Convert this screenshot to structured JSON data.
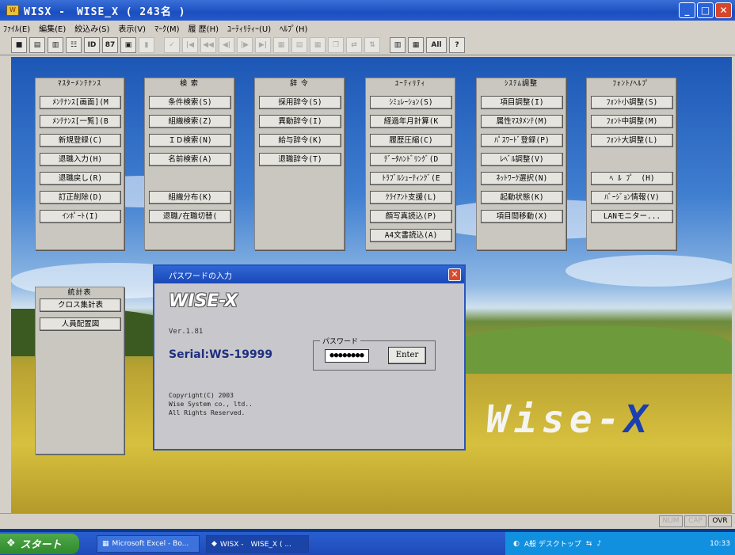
{
  "window": {
    "title": "WISX -　WISE_X ( 243名 )",
    "min": "_",
    "max": "□",
    "close": "✕"
  },
  "menu": [
    "ﾌｧｲﾙ(E)",
    "編集(E)",
    "絞込み(S)",
    "表示(V)",
    "ﾏｰｸ(M)",
    "履 歴(H)",
    "ﾕｰﾃｨﾘﾃｨｰ(U)",
    "ﾍﾙﾌﾟ(H)"
  ],
  "toolbar": {
    "id": "ID",
    "nums": "87",
    "all": "All",
    "help": "?"
  },
  "groups": [
    {
      "title": "ﾏｽﾀｰﾒﾝﾃﾅﾝｽ",
      "buttons": [
        "ﾒﾝﾃﾅﾝｽ[画面](M",
        "ﾒﾝﾃﾅﾝｽ[一覧](B",
        "新規登録(C)",
        "退職入力(H)",
        "退職戻し(R)",
        "訂正削除(D)",
        "ｲﾝﾎﾟｰﾄ(I)"
      ]
    },
    {
      "title": "検 索",
      "buttons": [
        "条件検索(S)",
        "組織検索(Z)",
        "ＩＤ検索(N)",
        "名前検索(A)",
        "組織分布(K)",
        "退職/在職切替("
      ]
    },
    {
      "title": "辞 令",
      "buttons": [
        "採用辞令(S)",
        "異動辞令(I)",
        "給与辞令(K)",
        "退職辞令(T)"
      ]
    },
    {
      "title": "ﾕｰﾃｨﾘﾃｨ",
      "buttons": [
        "ｼﾐｭﾚｰｼｮﾝ(S)",
        "経過年月計算(K",
        "履歴圧縮(C)",
        "ﾃﾞｰﾀﾊﾝﾄﾞﾘﾝｸﾞ(D",
        "ﾄﾗﾌﾞﾙｼｭｰﾃｨﾝｸﾞ(E",
        "ｸﾗｲｱﾝﾄ支援(L)",
        "顔写真読込(P)",
        "A4文書読込(A)"
      ]
    },
    {
      "title": "ｼｽﾃﾑ調整",
      "buttons": [
        "項目調整(I)",
        "属性ﾏｽﾀﾒﾝﾃ(M)",
        "ﾊﾟｽﾜｰﾄﾞ登録(P)",
        "ﾚﾍﾞﾙ調整(V)",
        "ﾈｯﾄﾜｰｸ選択(N)",
        "起動状態(K)",
        "項目間移動(X)"
      ]
    },
    {
      "title": "ﾌｫﾝﾄ/ﾍﾙﾌﾟ",
      "buttons": [
        "ﾌｫﾝﾄ小調整(S)",
        "ﾌｫﾝﾄ中調整(M)",
        "ﾌｫﾝﾄ大調整(L)",
        "ﾍ ﾙ ﾌﾟ　(H)",
        "ﾊﾞｰｼﾞｮﾝ情報(V)",
        "LANモニター..."
      ]
    },
    {
      "title": "統計表",
      "buttons": [
        "クロス集計表",
        "人員配置図"
      ]
    }
  ],
  "brand": {
    "main": "Wise-",
    "accent": "X"
  },
  "dialog": {
    "title": "パスワードの入力",
    "logo": "WISE-X",
    "version": "Ver.1.81",
    "serial": "Serial:WS-19999",
    "copyright": "Copyright(C) 2003\nWise System co., ltd..\nAll Rights Reserved.",
    "pw_label": "パスワード",
    "pw_value": "●●●●●●●●",
    "enter": "Enter",
    "close": "✕"
  },
  "status": {
    "num": "NUM",
    "cap": "CAP",
    "ovr": "OVR"
  },
  "taskbar": {
    "start": "スタート",
    "tasks": [
      "Microsoft Excel - Bo...",
      "WISX -　WISE_X (  ..."
    ],
    "tray": "A般 デスクトップ",
    "time": "10:33"
  },
  "colors": {
    "title_blue": "#1b4fc0",
    "desk_sky": "#3f7ed0",
    "field": "#d7c03e",
    "accent": "#1a3fb0"
  }
}
